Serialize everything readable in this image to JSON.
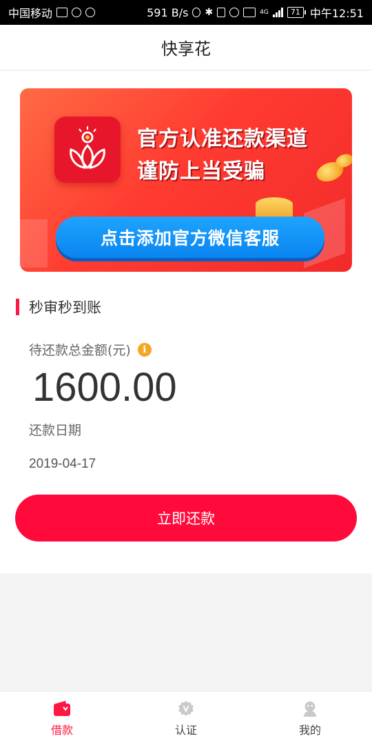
{
  "status_bar": {
    "carrier": "中国移动",
    "speed": "591 B/s",
    "network": "4G",
    "battery": "71",
    "time": "中午12:51"
  },
  "header": {
    "title": "快享花"
  },
  "banner": {
    "line1": "官方认准还款渠道",
    "line2": "谨防上当受骗",
    "button_label": "点击添加官方微信客服",
    "colors": {
      "background": "#ff3b30",
      "button": "#0a84f0"
    }
  },
  "section": {
    "title": "秒审秒到账"
  },
  "repayment": {
    "amount_label": "待还款总金额(元)",
    "info_icon": "i",
    "amount": "1600.00",
    "date_label": "还款日期",
    "date": "2019-04-17",
    "button_label": "立即还款"
  },
  "bottom_nav": {
    "items": [
      {
        "label": "借款",
        "icon": "wallet-icon",
        "active": true
      },
      {
        "label": "认证",
        "icon": "verified-badge-icon",
        "active": false
      },
      {
        "label": "我的",
        "icon": "user-icon",
        "active": false
      }
    ]
  },
  "colors": {
    "accent": "#ff1743",
    "button": "#ff0a3b",
    "info": "#f5a623"
  }
}
